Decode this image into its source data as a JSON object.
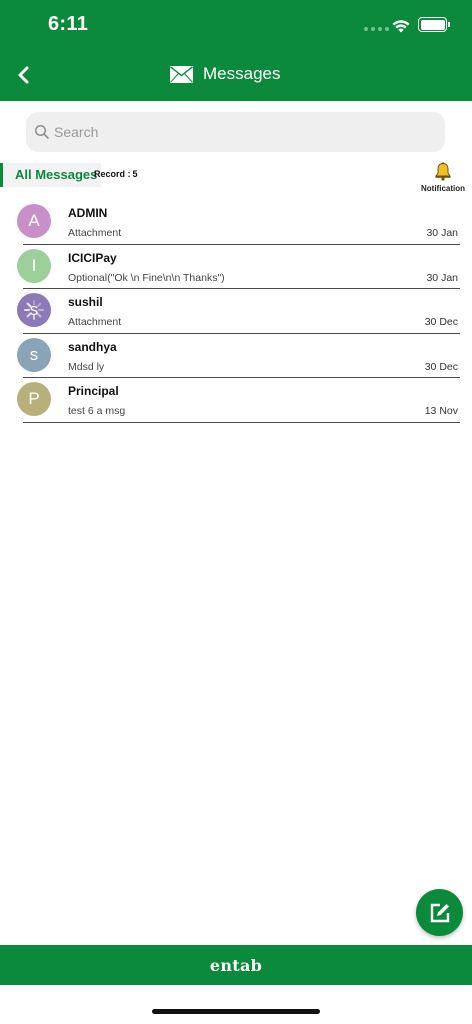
{
  "status_bar": {
    "time": "6:11"
  },
  "nav": {
    "title": "Messages",
    "back_icon": "chevron-left-icon",
    "title_icon": "envelope-icon"
  },
  "search": {
    "placeholder": "Search",
    "value": ""
  },
  "tab": {
    "label": "All Messages",
    "record_label": "Record :",
    "record_count": "5"
  },
  "notification": {
    "label": "Notification",
    "icon": "bell-icon"
  },
  "messages": [
    {
      "initial": "A",
      "name": "ADMIN",
      "preview": "Attachment",
      "date": "30 Jan",
      "color": "#c98fc9"
    },
    {
      "initial": "I",
      "name": "ICICIPay",
      "preview": "Optional(\"Ok \\n Fine\\n\\n Thanks\")",
      "date": "30 Jan",
      "color": "#9ccf9c"
    },
    {
      "initial": "s",
      "name": "sushil",
      "preview": "Attachment",
      "date": "30 Dec",
      "color": "#8c7ab8"
    },
    {
      "initial": "s",
      "name": "sandhya",
      "preview": "Mdsd ly",
      "date": "30 Dec",
      "color": "#8ba3b6"
    },
    {
      "initial": "P",
      "name": "Principal",
      "preview": "test 6 a msg",
      "date": "13 Nov",
      "color": "#b8b07a"
    }
  ],
  "fab": {
    "icon": "compose-icon"
  },
  "footer": {
    "brand": "entab"
  },
  "colors": {
    "primary": "#0a8a3a"
  }
}
